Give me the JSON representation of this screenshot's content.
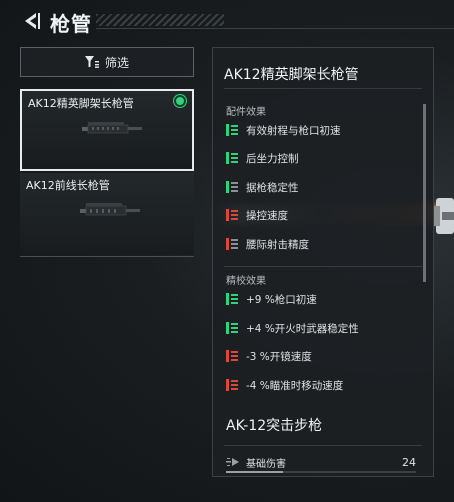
{
  "header": {
    "title": "枪管"
  },
  "filter": {
    "label": "筛选"
  },
  "attachments": [
    {
      "name": "AK12精英脚架长枪管",
      "selected": true
    },
    {
      "name": "AK12前线长枪管",
      "selected": false
    }
  ],
  "details": {
    "title": "AK12精英脚架长枪管",
    "attachment_section": "配件效果",
    "attachment_effects": [
      {
        "label": "有效射程与枪口初速",
        "polarity": "positive"
      },
      {
        "label": "后坐力控制",
        "polarity": "positive"
      },
      {
        "label": "据枪稳定性",
        "polarity": "mixed"
      },
      {
        "label": "操控速度",
        "polarity": "negative"
      },
      {
        "label": "腰际射击精度",
        "polarity": "negative"
      }
    ],
    "calibration_section": "精校效果",
    "calibration_effects": [
      {
        "label": "+9 %枪口初速",
        "polarity": "positive"
      },
      {
        "label": "+4 %开火时武器稳定性",
        "polarity": "positive"
      },
      {
        "label": "-3 %开镜速度",
        "polarity": "negative"
      },
      {
        "label": "-4 %瞄准时移动速度",
        "polarity": "negative"
      }
    ],
    "weapon_name": "AK-12突击步枪",
    "stat": {
      "label": "基础伤害",
      "value": "24",
      "fill_fraction": 0.3
    }
  },
  "colors": {
    "positive": "#2ed47a",
    "negative": "#e0453a",
    "mixed": "#8a9095",
    "selected_dot": "#2ed47a"
  }
}
